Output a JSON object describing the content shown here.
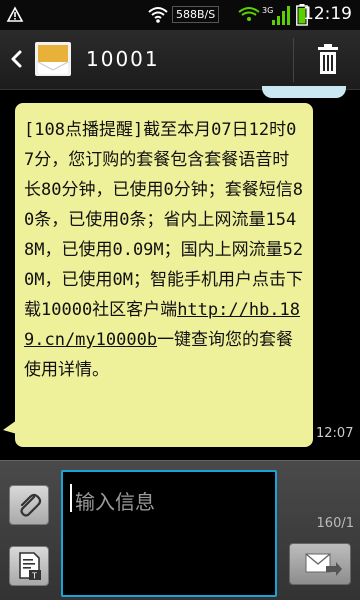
{
  "status_bar": {
    "network_speed": "588B/S",
    "time": "12:19",
    "icons": [
      "notification-icon",
      "wifi-icon",
      "data-arrows-icon",
      "signal-3g-icon",
      "battery-icon"
    ]
  },
  "header": {
    "contact_name": "10001",
    "icons": {
      "back": "back-arrow-icon",
      "avatar": "envelope-icon",
      "delete": "trash-icon"
    }
  },
  "message": {
    "text_before_link": "[108点播提醒]截至本月07日12时07分，您订购的套餐包含套餐语音时长80分钟，已使用0分钟；套餐短信80条，已使用0条；省内上网流量1548M，已使用0.09M；国内上网流量520M，已使用0M；智能手机用户点击下载10000社区客户端",
    "link": "http://hb.189.cn/my10000b",
    "text_after_link": "一键查询您的套餐使用详情。",
    "time": "12:07"
  },
  "compose": {
    "placeholder": "输入信息",
    "char_count": "160/1",
    "icons": {
      "attach": "paperclip-icon",
      "template": "template-icon",
      "send": "send-icon"
    }
  },
  "colors": {
    "bubble": "#eff09a",
    "input_border": "#1aa3d9",
    "prev_bubble": "#c9e8f3"
  }
}
